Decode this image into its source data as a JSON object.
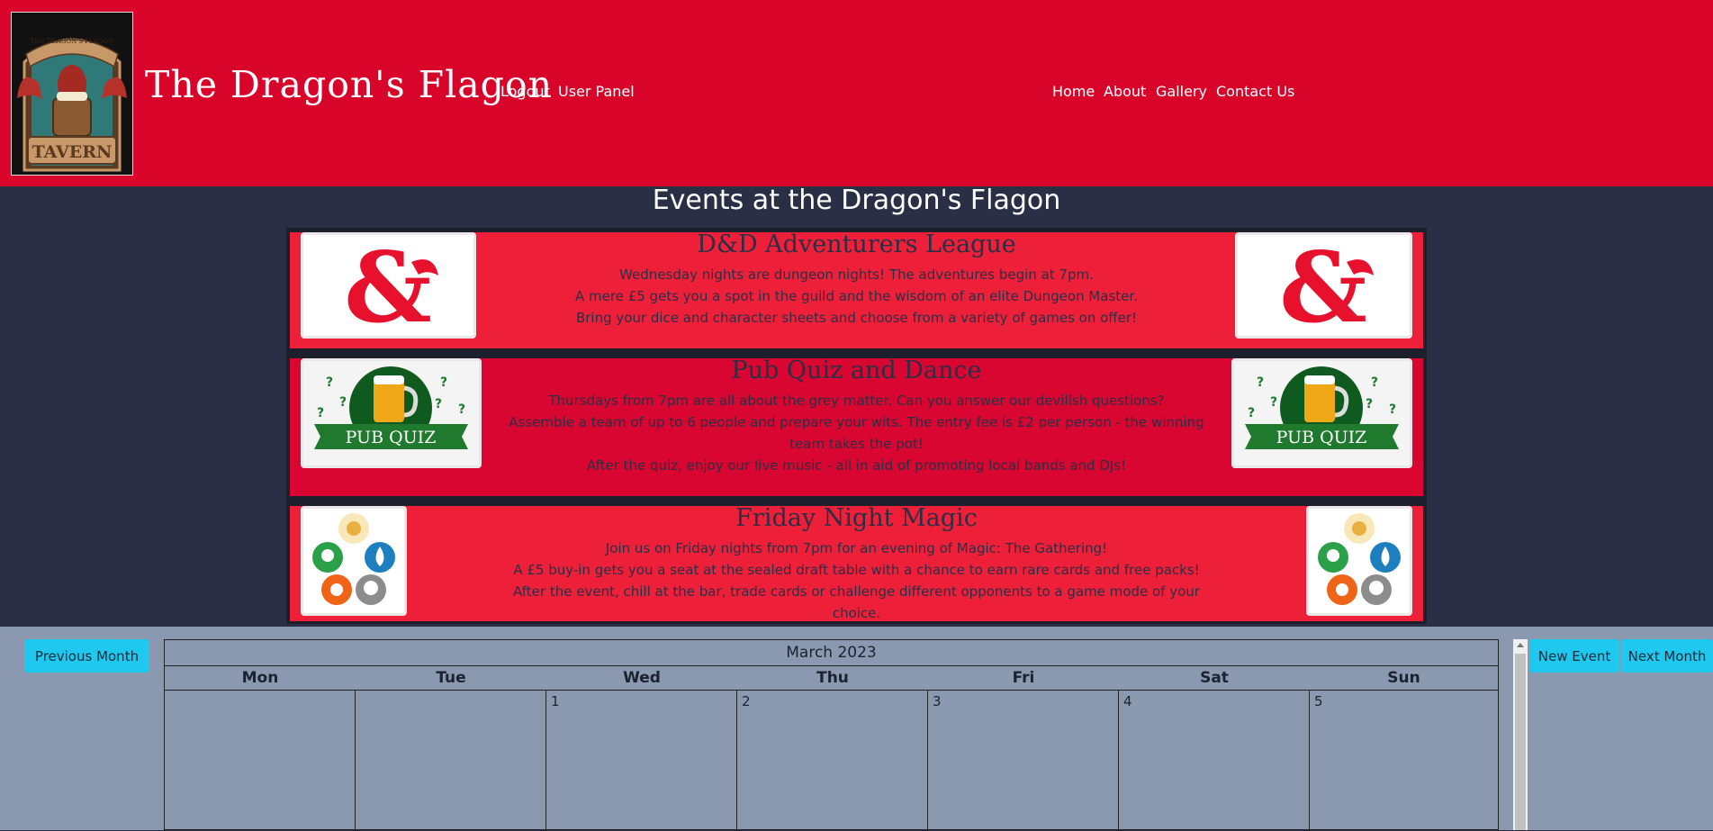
{
  "header": {
    "site_title": "The Dragon's Flagon",
    "logo_text_top": "THE DRAGON'S FLAGON",
    "logo_text_bottom": "TAVERN",
    "user_links": [
      "Logout",
      "User Panel"
    ],
    "nav_links": [
      "Home",
      "About",
      "Gallery",
      "Contact Us"
    ]
  },
  "events": {
    "title": "Events at the Dragon's Flagon",
    "items": [
      {
        "title": "D&D Adventurers League",
        "lines": [
          "Wednesday nights are dungeon nights! The adventures begin at 7pm.",
          "A mere £5 gets you a spot in the guild and the wisdom of an elite Dungeon Master.",
          "Bring your dice and character sheets and choose from a variety of games on offer!"
        ],
        "image_icon": "dnd-ampersand-icon"
      },
      {
        "title": "Pub Quiz and Dance",
        "lines": [
          "Thursdays from 7pm are all about the grey matter. Can you answer our devilish questions?",
          "Assemble a team of up to 6 people and prepare your wits. The entry fee is £2 per person - the winning team takes the pot!",
          "After the quiz, enjoy our live music - all in aid of promoting local bands and DJs!"
        ],
        "image_label": "PUB QUIZ",
        "image_icon": "pub-quiz-icon"
      },
      {
        "title": "Friday Night Magic",
        "lines": [
          "Join us on Friday nights from 7pm for an evening of Magic: The Gathering!",
          "A £5 buy-in gets you a seat at the sealed draft table with a chance to earn rare cards and free packs!",
          "After the event, chill at the bar, trade cards or challenge different opponents to a game mode of your choice."
        ],
        "image_icon": "mtg-mana-icon"
      }
    ]
  },
  "calendar": {
    "prev_label": "Previous Month",
    "new_event_label": "New Event",
    "next_label": "Next Month",
    "month_label": "March 2023",
    "weekdays": [
      "Mon",
      "Tue",
      "Wed",
      "Thu",
      "Fri",
      "Sat",
      "Sun"
    ],
    "first_week": [
      "",
      "",
      "1",
      "2",
      "3",
      "4",
      "5"
    ]
  },
  "colors": {
    "header_red": "#d9042a",
    "event_red": "#ee2039",
    "page_navy": "#2b2f45",
    "calendar_bg": "#8a98b0",
    "button_cyan": "#1ec8ef"
  }
}
